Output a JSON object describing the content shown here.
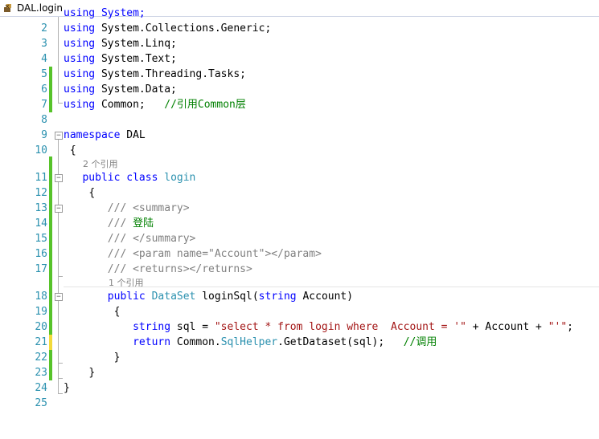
{
  "tab": {
    "title": "DAL.login",
    "icon": "csharp-file-icon"
  },
  "references": {
    "class_refs": "2 个引用",
    "method_refs": "1 个引用"
  },
  "lines": [
    {
      "n": "2",
      "k1": "using",
      "rest": " System.Collections.Generic;"
    },
    {
      "n": "3",
      "k1": "using",
      "rest": " System.Linq;"
    },
    {
      "n": "4",
      "k1": "using",
      "rest": " System.Text;"
    },
    {
      "n": "5",
      "k1": "using",
      "rest": " System.Threading.Tasks;"
    },
    {
      "n": "6",
      "k1": "using",
      "rest": " System.Data;"
    },
    {
      "n": "7",
      "k1": "using",
      "rest": " Common;",
      "comment": "//引用Common层"
    },
    {
      "n": "8"
    },
    {
      "n": "9",
      "k1": "namespace",
      "rest": " DAL"
    },
    {
      "n": "10",
      "text": "{"
    },
    {
      "n": "11",
      "k1": "public",
      "k2": "class",
      "type": "login"
    },
    {
      "n": "12",
      "text": "{"
    },
    {
      "n": "13",
      "doc1": "/// ",
      "doc2": "<summary>"
    },
    {
      "n": "14",
      "doc1": "/// ",
      "doc2": "登陆"
    },
    {
      "n": "15",
      "doc1": "/// ",
      "doc2": "</summary>"
    },
    {
      "n": "16",
      "doc1": "/// ",
      "doc2": "<param name=\"Account\"></param>"
    },
    {
      "n": "17",
      "doc1": "/// ",
      "doc2": "<returns></returns>"
    },
    {
      "n": "18",
      "k1": "public",
      "type": "DataSet",
      "mid": " loginSql(",
      "k2": "string",
      "tail": " Account)"
    },
    {
      "n": "19",
      "text": "{"
    },
    {
      "n": "20",
      "k1": "string",
      "mid": " sql = ",
      "str1": "\"select * from login where  Account = '\"",
      "mid2": " + Account + ",
      "str2": "\"'\"",
      "tail": ";"
    },
    {
      "n": "21",
      "k1": "return",
      "mid": " Common.",
      "type": "SqlHelper",
      "tail": ".GetDataset(sql);",
      "comment": "//调用"
    },
    {
      "n": "22",
      "text": "}"
    },
    {
      "n": "23",
      "text": "}"
    },
    {
      "n": "24",
      "text": "}"
    },
    {
      "n": "25"
    }
  ]
}
